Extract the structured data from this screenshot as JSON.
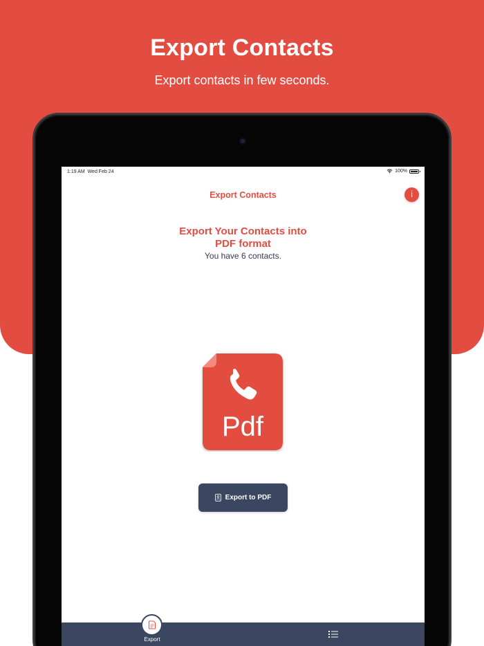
{
  "hero": {
    "title": "Export Contacts",
    "subtitle": "Export contacts in few seconds."
  },
  "status_bar": {
    "time": "1:19 AM",
    "date": "Wed Feb 24",
    "battery": "100%",
    "wifi_icon": "wifi-icon",
    "battery_icon": "battery-icon"
  },
  "nav": {
    "title": "Export Contacts",
    "info_label": "i"
  },
  "main": {
    "headline_line1": "Export Your Contacts into",
    "headline_line2": "PDF format",
    "count_text": "You have 6 contacts.",
    "logo_text": "Pdf",
    "logo_icon": "phone-icon",
    "export_button_label": "Export to PDF",
    "export_button_icon": "contact-book-icon"
  },
  "tab_bar": {
    "tabs": [
      {
        "label": "Export",
        "icon": "export-document-icon",
        "active": true
      },
      {
        "label": "",
        "icon": "list-icon",
        "active": false
      }
    ]
  },
  "colors": {
    "accent": "#e34d41",
    "navy": "#3b4660",
    "text_dark": "#333a4d",
    "device": "#050505"
  }
}
